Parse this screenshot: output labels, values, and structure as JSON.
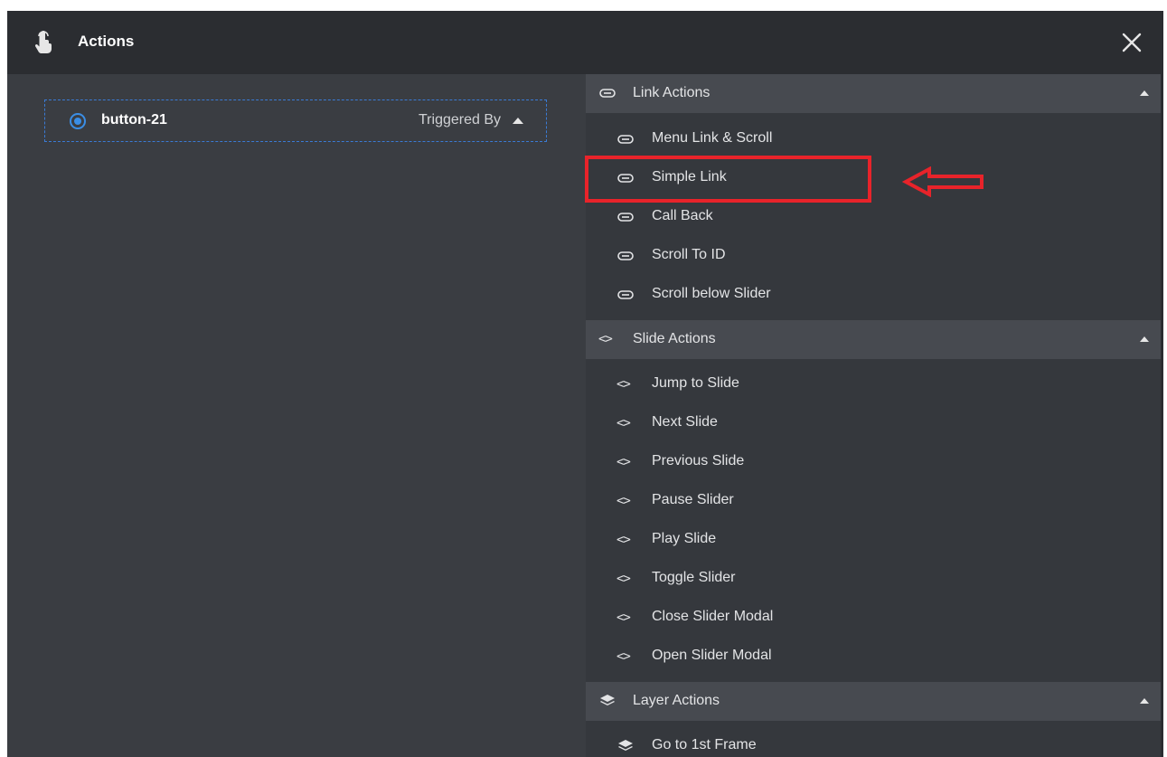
{
  "header": {
    "title": "Actions",
    "hand_icon": "hand-pointer-icon",
    "close_icon": "close-icon"
  },
  "trigger": {
    "name": "button-21",
    "triggered_by_label": "Triggered By"
  },
  "groups": [
    {
      "label": "Link Actions",
      "icon": "link-icon",
      "items": [
        "Menu Link & Scroll",
        "Simple Link",
        "Call Back",
        "Scroll To ID",
        "Scroll below Slider"
      ]
    },
    {
      "label": "Slide Actions",
      "icon": "code-icon",
      "items": [
        "Jump to Slide",
        "Next Slide",
        "Previous Slide",
        "Pause Slider",
        "Play Slide",
        "Toggle Slider",
        "Close Slider Modal",
        "Open Slider Modal"
      ]
    },
    {
      "label": "Layer Actions",
      "icon": "layers-icon",
      "items": [
        "Go to 1st Frame"
      ]
    }
  ],
  "annotation": {
    "highlighted_item": "Simple Link",
    "color": "#e8232a"
  },
  "colors": {
    "accent": "#3a8ee6",
    "header_bg": "#2b2d31",
    "panel_bg": "#3a3d42",
    "group_bg": "#474a50"
  }
}
